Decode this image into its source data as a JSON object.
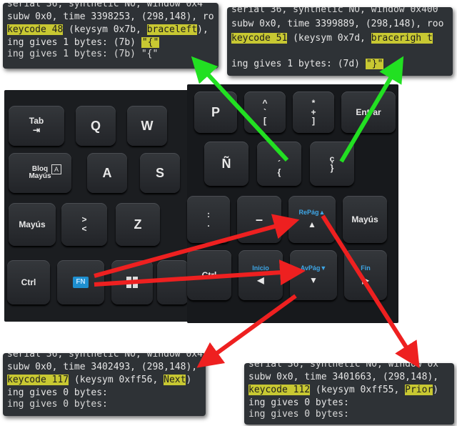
{
  "terminals": {
    "tl": {
      "l0": "serial 36, synthetic NO, window 0x4",
      "l1": "subw 0x0, time 3398253, (298,148), ro",
      "l2": {
        "code": "keycode 48",
        "mid": " (keysym 0x7b, ",
        "name": "braceleft",
        "end": "),"
      },
      "l3a": "ing gives 1 bytes: (7b) ",
      "l3b": "\"{\"",
      "l4": "ing gives 1 bytes: (7b) \"{\""
    },
    "tr": {
      "l0": "serial 36, synthetic NO, window 0x400",
      "l1": "subw 0x0, time 3399889, (298,148), roo",
      "l2": {
        "code": "keycode 51",
        "mid": " (keysym 0x7d, ",
        "name": "bracerigh t",
        "end": ""
      },
      "l3a": "ing gives 1 bytes: (7d) ",
      "l3b": "\"}\""
    },
    "bl": {
      "l0": "serial 36, synthetic NO, window 0x4",
      "l1": "subw 0x0, time 3402493, (298,148), ",
      "l2": {
        "code": "keycode 117",
        "mid": " (keysym 0xff56, ",
        "name": "Next",
        "end": ")"
      },
      "l3": "ing gives 0 bytes:",
      "l4": "ing gives 0 bytes:"
    },
    "br": {
      "l0": "serial 36, synthetic NO, window 0x",
      "l1": "subw 0x0, time 3401663, (298,148), ",
      "l2": {
        "code": "keycode 112",
        "mid": " (keysym 0xff55, ",
        "name": "Prior",
        "end": ")"
      },
      "l3": "ing gives 0 bytes:",
      "l4": "ing gives 0 bytes:"
    }
  },
  "keys": {
    "tab": "Tab",
    "tab_icon": "⇥",
    "q": "Q",
    "w": "W",
    "bloq1": "Bloq",
    "bloq2": "Mayús",
    "bloq_icon": "A",
    "a": "A",
    "s": "S",
    "mayus_left": "Mayús",
    "gt": ">",
    "lt": "<",
    "z": "Z",
    "ctrl_left": "Ctrl",
    "fn": "FN",
    "p": "P",
    "caret": "^",
    "grave": "`",
    "bracket_open": "[",
    "star": "*",
    "plus": "+",
    "bracket_close": "]",
    "entrar": "Entrar",
    "n_tilde": "Ñ",
    "diaeresis": "¨",
    "acute": "´",
    "brace_open": "{",
    "c_cedilla": "ç",
    "brace_close": "}",
    "colon": ":",
    "period": ".",
    "minus": "–",
    "repag": "RePág▲",
    "up_arrow": "▲",
    "mayus_right": "Mayús",
    "ctrl_right": "Ctrl",
    "inicio": "Inicio",
    "left_arrow": "◀",
    "avpag": "AvPág▼",
    "down_arrow": "▼",
    "fin": "Fin",
    "right_arrow": "▶"
  },
  "colors": {
    "highlight": "#c8c832",
    "arrow_green": "#22e022",
    "arrow_red": "#ee2020",
    "key_blue_label": "#3ea6e6"
  }
}
